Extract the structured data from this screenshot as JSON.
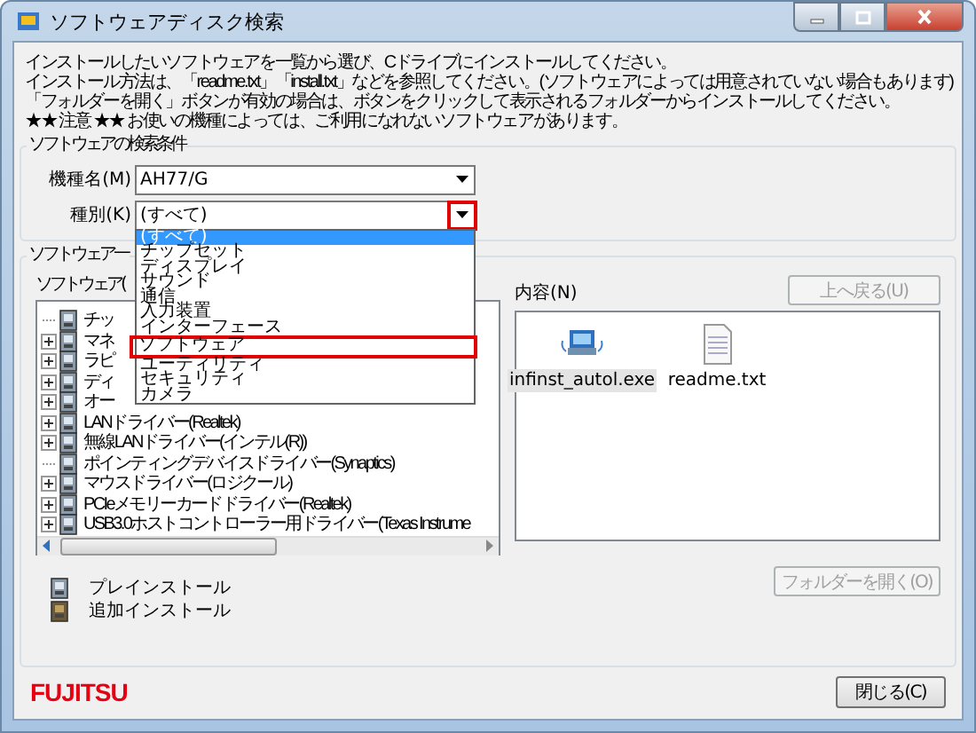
{
  "window": {
    "title": "ソフトウェアディスク検索"
  },
  "instructions": [
    "インストールしたいソフトウェアを一覧から選び、Cドライブにインストールしてください。",
    "インストール方法は、「readme.txt」「install.txt」などを参照してください。(ソフトウェアによっては用意されていない場合もあります)",
    "「フォルダーを開く」ボタンが有効の場合は、ボタンをクリックして表示されるフォルダーからインストールしてください。",
    "★★ 注意 ★★ お使いの機種によっては、ご利用になれないソフトウェアがあります。"
  ],
  "search_conditions": {
    "label": "ソフトウェアの検索条件",
    "model": {
      "label": "機種名(M)",
      "value": "AH77/G"
    },
    "type": {
      "label": "種別(K)",
      "value": "(すべて)",
      "expanded": true,
      "highlighted": true,
      "options": [
        {
          "label": "(すべて)",
          "selected": true,
          "highlighted": false
        },
        {
          "label": "チップセット",
          "selected": false,
          "highlighted": false
        },
        {
          "label": "ディスプレイ",
          "selected": false,
          "highlighted": false
        },
        {
          "label": "サウンド",
          "selected": false,
          "highlighted": false
        },
        {
          "label": "通信",
          "selected": false,
          "highlighted": false
        },
        {
          "label": "入力装置",
          "selected": false,
          "highlighted": false
        },
        {
          "label": "インターフェース",
          "selected": false,
          "highlighted": false
        },
        {
          "label": "ソフトウェア",
          "selected": false,
          "highlighted": true
        },
        {
          "label": "ユーティリティ",
          "selected": false,
          "highlighted": false
        },
        {
          "label": "セキュリティ",
          "selected": false,
          "highlighted": false
        },
        {
          "label": "カメラ",
          "selected": false,
          "highlighted": false
        }
      ]
    }
  },
  "software_list": {
    "label": "ソフトウェア一",
    "tree_label": "ソフトウェア(",
    "items": [
      {
        "label": "チッ",
        "expandable": false
      },
      {
        "label": "マネ",
        "expandable": true
      },
      {
        "label": "ラピ",
        "expandable": true
      },
      {
        "label": "ディ",
        "expandable": true
      },
      {
        "label": "オー",
        "expandable": true
      },
      {
        "label": "LANドライバー(Realtek)",
        "expandable": true
      },
      {
        "label": "無線LANドライバー(インテル(R))",
        "expandable": true
      },
      {
        "label": "ポインティングデバイスドライバー(Synaptics)",
        "expandable": false
      },
      {
        "label": "マウスドライバー(ロジクール)",
        "expandable": true
      },
      {
        "label": "PCIeメモリーカードドライバー(Realtek)",
        "expandable": true
      },
      {
        "label": "USB3.0ホストコントローラー用ドライバー(Texas Instrume",
        "expandable": true
      }
    ],
    "legend": [
      {
        "kind": "preinstalled",
        "label": "プレインストール"
      },
      {
        "kind": "additional",
        "label": "追加インストール"
      }
    ]
  },
  "contents": {
    "label": "内容(N)",
    "up_button": {
      "label": "上へ戻る(U)",
      "disabled": true
    },
    "files": [
      {
        "name": "infinst_autol.exe",
        "kind": "program",
        "selected": true
      },
      {
        "name": "readme.txt",
        "kind": "text",
        "selected": false
      }
    ],
    "open_folder_button": {
      "label": "フォルダーを開く(O)",
      "disabled": true
    }
  },
  "footer": {
    "logo": "FUJITSU",
    "close_button": {
      "label": "閉じる(C)",
      "disabled": false
    }
  }
}
